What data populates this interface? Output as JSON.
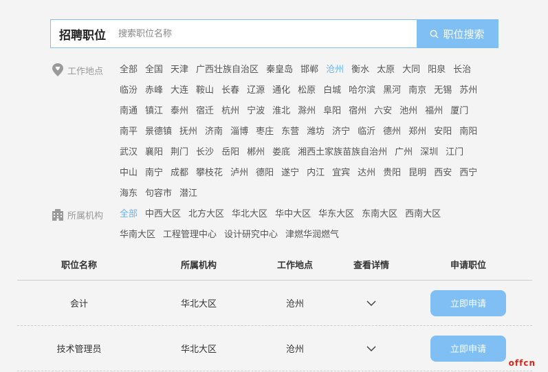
{
  "search": {
    "label": "招聘职位",
    "placeholder": "搜索职位名称",
    "button_label": "职位搜索"
  },
  "filters": {
    "location": {
      "label": "工作地点",
      "icon": "map-pin-icon",
      "active": "沧州",
      "options": [
        "全部",
        "全国",
        "天津",
        "广西壮族自治区",
        "秦皇岛",
        "邯郸",
        "沧州",
        "衡水",
        "太原",
        "大同",
        "阳泉",
        "长治",
        "临汾",
        "赤峰",
        "大连",
        "鞍山",
        "长春",
        "辽源",
        "通化",
        "松原",
        "白城",
        "哈尔滨",
        "黑河",
        "南京",
        "无锡",
        "苏州",
        "南通",
        "镇江",
        "泰州",
        "宿迁",
        "杭州",
        "宁波",
        "淮北",
        "滁州",
        "阜阳",
        "宿州",
        "六安",
        "池州",
        "福州",
        "厦门",
        "南平",
        "景德镇",
        "抚州",
        "济南",
        "淄博",
        "枣庄",
        "东营",
        "潍坊",
        "济宁",
        "临沂",
        "德州",
        "郑州",
        "安阳",
        "南阳",
        "武汉",
        "襄阳",
        "荆门",
        "长沙",
        "岳阳",
        "郴州",
        "娄底",
        "湘西土家族苗族自治州",
        "广州",
        "深圳",
        "江门",
        "中山",
        "南宁",
        "成都",
        "攀枝花",
        "泸州",
        "德阳",
        "遂宁",
        "内江",
        "宜宾",
        "达州",
        "贵阳",
        "昆明",
        "西安",
        "西宁",
        "海东",
        "句容市",
        "潜江"
      ]
    },
    "organization": {
      "label": "所属机构",
      "icon": "building-icon",
      "active": "全部",
      "options": [
        "全部",
        "中西大区",
        "北方大区",
        "华北大区",
        "华中大区",
        "华东大区",
        "东南大区",
        "西南大区",
        "华南大区",
        "工程管理中心",
        "设计研究中心",
        "津燃华润燃气"
      ]
    }
  },
  "table": {
    "headers": [
      "职位名称",
      "所属机构",
      "工作地点",
      "查看详情",
      "申请职位"
    ],
    "rows": [
      {
        "title": "会计",
        "org": "华北大区",
        "location": "沧州",
        "apply_label": "立即申请"
      },
      {
        "title": "技术管理员",
        "org": "华北大区",
        "location": "沧州",
        "apply_label": "立即申请"
      }
    ]
  },
  "watermark": "offcn",
  "colors": {
    "accent": "#7fbff3",
    "active_tag": "#6cb3ee",
    "watermark": "#e2231a"
  }
}
